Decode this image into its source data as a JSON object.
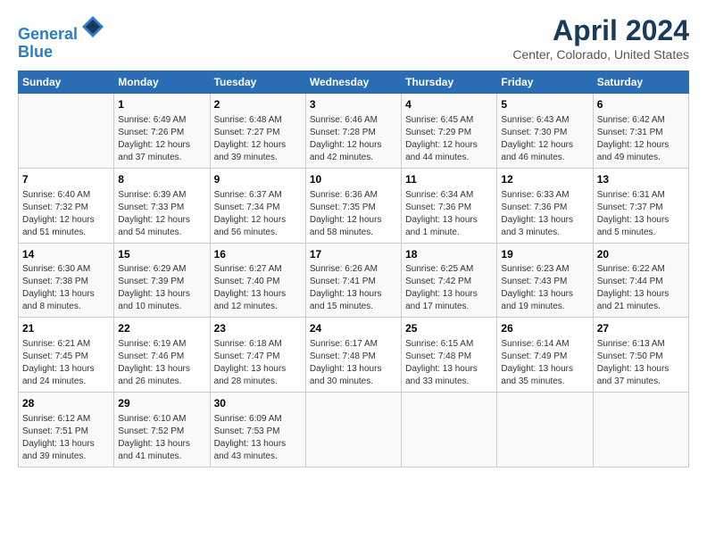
{
  "header": {
    "logo_line1": "General",
    "logo_line2": "Blue",
    "main_title": "April 2024",
    "subtitle": "Center, Colorado, United States"
  },
  "days_of_week": [
    "Sunday",
    "Monday",
    "Tuesday",
    "Wednesday",
    "Thursday",
    "Friday",
    "Saturday"
  ],
  "weeks": [
    [
      {
        "num": "",
        "info": ""
      },
      {
        "num": "1",
        "info": "Sunrise: 6:49 AM\nSunset: 7:26 PM\nDaylight: 12 hours\nand 37 minutes."
      },
      {
        "num": "2",
        "info": "Sunrise: 6:48 AM\nSunset: 7:27 PM\nDaylight: 12 hours\nand 39 minutes."
      },
      {
        "num": "3",
        "info": "Sunrise: 6:46 AM\nSunset: 7:28 PM\nDaylight: 12 hours\nand 42 minutes."
      },
      {
        "num": "4",
        "info": "Sunrise: 6:45 AM\nSunset: 7:29 PM\nDaylight: 12 hours\nand 44 minutes."
      },
      {
        "num": "5",
        "info": "Sunrise: 6:43 AM\nSunset: 7:30 PM\nDaylight: 12 hours\nand 46 minutes."
      },
      {
        "num": "6",
        "info": "Sunrise: 6:42 AM\nSunset: 7:31 PM\nDaylight: 12 hours\nand 49 minutes."
      }
    ],
    [
      {
        "num": "7",
        "info": "Sunrise: 6:40 AM\nSunset: 7:32 PM\nDaylight: 12 hours\nand 51 minutes."
      },
      {
        "num": "8",
        "info": "Sunrise: 6:39 AM\nSunset: 7:33 PM\nDaylight: 12 hours\nand 54 minutes."
      },
      {
        "num": "9",
        "info": "Sunrise: 6:37 AM\nSunset: 7:34 PM\nDaylight: 12 hours\nand 56 minutes."
      },
      {
        "num": "10",
        "info": "Sunrise: 6:36 AM\nSunset: 7:35 PM\nDaylight: 12 hours\nand 58 minutes."
      },
      {
        "num": "11",
        "info": "Sunrise: 6:34 AM\nSunset: 7:36 PM\nDaylight: 13 hours\nand 1 minute."
      },
      {
        "num": "12",
        "info": "Sunrise: 6:33 AM\nSunset: 7:36 PM\nDaylight: 13 hours\nand 3 minutes."
      },
      {
        "num": "13",
        "info": "Sunrise: 6:31 AM\nSunset: 7:37 PM\nDaylight: 13 hours\nand 5 minutes."
      }
    ],
    [
      {
        "num": "14",
        "info": "Sunrise: 6:30 AM\nSunset: 7:38 PM\nDaylight: 13 hours\nand 8 minutes."
      },
      {
        "num": "15",
        "info": "Sunrise: 6:29 AM\nSunset: 7:39 PM\nDaylight: 13 hours\nand 10 minutes."
      },
      {
        "num": "16",
        "info": "Sunrise: 6:27 AM\nSunset: 7:40 PM\nDaylight: 13 hours\nand 12 minutes."
      },
      {
        "num": "17",
        "info": "Sunrise: 6:26 AM\nSunset: 7:41 PM\nDaylight: 13 hours\nand 15 minutes."
      },
      {
        "num": "18",
        "info": "Sunrise: 6:25 AM\nSunset: 7:42 PM\nDaylight: 13 hours\nand 17 minutes."
      },
      {
        "num": "19",
        "info": "Sunrise: 6:23 AM\nSunset: 7:43 PM\nDaylight: 13 hours\nand 19 minutes."
      },
      {
        "num": "20",
        "info": "Sunrise: 6:22 AM\nSunset: 7:44 PM\nDaylight: 13 hours\nand 21 minutes."
      }
    ],
    [
      {
        "num": "21",
        "info": "Sunrise: 6:21 AM\nSunset: 7:45 PM\nDaylight: 13 hours\nand 24 minutes."
      },
      {
        "num": "22",
        "info": "Sunrise: 6:19 AM\nSunset: 7:46 PM\nDaylight: 13 hours\nand 26 minutes."
      },
      {
        "num": "23",
        "info": "Sunrise: 6:18 AM\nSunset: 7:47 PM\nDaylight: 13 hours\nand 28 minutes."
      },
      {
        "num": "24",
        "info": "Sunrise: 6:17 AM\nSunset: 7:48 PM\nDaylight: 13 hours\nand 30 minutes."
      },
      {
        "num": "25",
        "info": "Sunrise: 6:15 AM\nSunset: 7:48 PM\nDaylight: 13 hours\nand 33 minutes."
      },
      {
        "num": "26",
        "info": "Sunrise: 6:14 AM\nSunset: 7:49 PM\nDaylight: 13 hours\nand 35 minutes."
      },
      {
        "num": "27",
        "info": "Sunrise: 6:13 AM\nSunset: 7:50 PM\nDaylight: 13 hours\nand 37 minutes."
      }
    ],
    [
      {
        "num": "28",
        "info": "Sunrise: 6:12 AM\nSunset: 7:51 PM\nDaylight: 13 hours\nand 39 minutes."
      },
      {
        "num": "29",
        "info": "Sunrise: 6:10 AM\nSunset: 7:52 PM\nDaylight: 13 hours\nand 41 minutes."
      },
      {
        "num": "30",
        "info": "Sunrise: 6:09 AM\nSunset: 7:53 PM\nDaylight: 13 hours\nand 43 minutes."
      },
      {
        "num": "",
        "info": ""
      },
      {
        "num": "",
        "info": ""
      },
      {
        "num": "",
        "info": ""
      },
      {
        "num": "",
        "info": ""
      }
    ]
  ]
}
